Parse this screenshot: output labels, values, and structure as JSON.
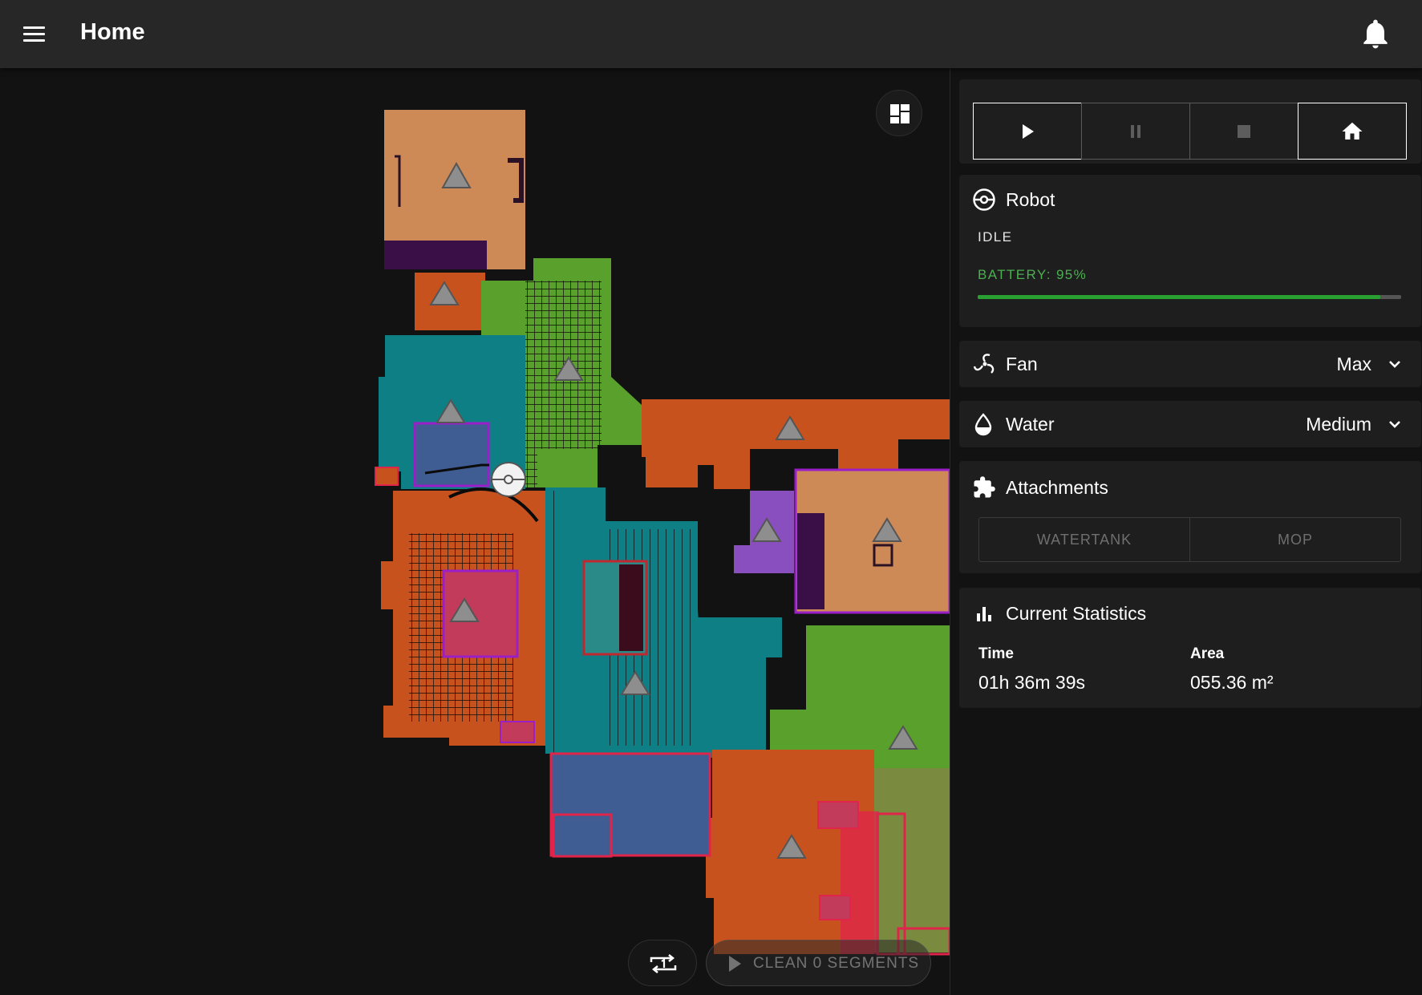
{
  "header": {
    "title": "Home",
    "menu_icon": "menu-icon",
    "bell_icon": "bell-icon"
  },
  "controls": {
    "icons": [
      "play-icon",
      "pause-icon",
      "stop-icon",
      "home-icon"
    ],
    "active": [
      "play",
      "home"
    ]
  },
  "robot": {
    "title": "Robot",
    "state": "IDLE",
    "battery_label": "BATTERY: 95%",
    "battery_level": 0.95,
    "battery_color": "#4caf50"
  },
  "fan": {
    "title": "Fan",
    "value": "Max"
  },
  "water": {
    "title": "Water",
    "value": "Medium"
  },
  "attachments": {
    "title": "Attachments",
    "items": [
      "WATERTANK",
      "MOP"
    ]
  },
  "stats": {
    "title": "Current Statistics",
    "time_label": "Time",
    "time_value": "01h 36m 39s",
    "area_label": "Area",
    "area_value": "055.36 m²"
  },
  "map": {
    "clean_label": "CLEAN 0 SEGMENTS",
    "segment_colors": {
      "orange": "#c8521e",
      "teal": "#0f7f86",
      "green": "#5aa02c",
      "tan": "#cd8a57",
      "purple": "#8a4fbf",
      "blue": "#3f5d92"
    },
    "zone_colors": {
      "no_go": "#e0244a",
      "no_mop": "#9b1fc8"
    }
  }
}
